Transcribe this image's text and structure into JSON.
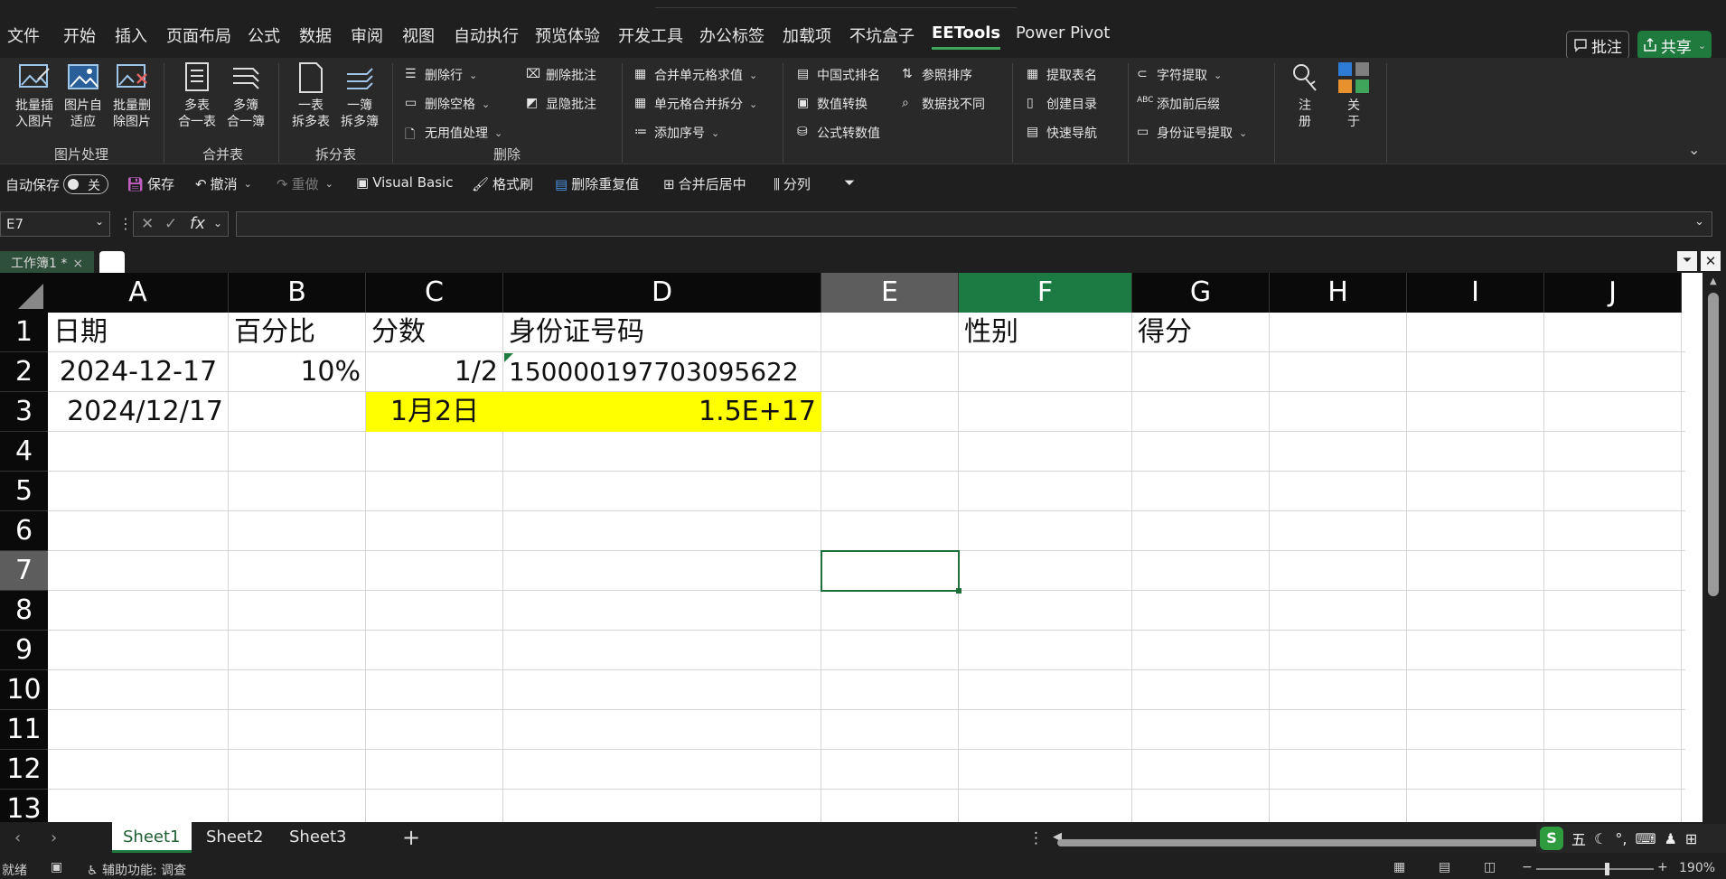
{
  "menu": {
    "tabs": [
      "文件",
      "开始",
      "插入",
      "页面布局",
      "公式",
      "数据",
      "审阅",
      "视图",
      "自动执行",
      "预览体验",
      "开发工具",
      "办公标签",
      "加载项",
      "不坑盒子",
      "EETools",
      "Power Pivot"
    ],
    "active_tab": "EETools",
    "comment_btn": "批注",
    "share_btn": "共享"
  },
  "ribbon": {
    "img_group": {
      "label": "图片处理",
      "btn1": "批量插\n入图片",
      "btn2": "图片自\n适应",
      "btn3": "批量删\n除图片"
    },
    "merge_group": {
      "label": "合并表",
      "btn1": "多表\n合一表",
      "btn2": "多簿\n合一簿"
    },
    "split_group": {
      "label": "拆分表",
      "btn1": "一表\n拆多表",
      "btn2": "一簿\n拆多簿"
    },
    "delete_group": {
      "label": "删除",
      "del_row": "删除行",
      "del_space": "删除空格",
      "useless": "无用值处理",
      "del_comment": "删除批注",
      "show_comment": "显隐批注"
    },
    "cell_group": {
      "merge_sum": "合并单元格求值",
      "merge_split": "单元格合并拆分",
      "add_seq": "添加序号"
    },
    "rank_group": {
      "cn_rank": "中国式排名",
      "num_convert": "数值转换",
      "formula_to_value": "公式转数值",
      "ref_sort": "参照排序",
      "data_diff": "数据找不同"
    },
    "nav_group": {
      "extract_name": "提取表名",
      "create_toc": "创建目录",
      "quick_nav": "快速导航"
    },
    "text_group": {
      "char_extract": "字符提取",
      "add_fix": "添加前后缀",
      "id_extract": "身份证号提取"
    },
    "reg_btn": "注\n册",
    "about_btn": "关\n于"
  },
  "qat": {
    "autosave": "自动保存",
    "toggle_state": "关",
    "save": "保存",
    "undo": "撤消",
    "redo": "重做",
    "vb": "Visual Basic",
    "format_painter": "格式刷",
    "remove_dup": "删除重复值",
    "merge_center": "合并后居中",
    "split_col": "分列"
  },
  "formula_bar": {
    "name_box": "E7",
    "fx": "fx",
    "value": ""
  },
  "workbook_tab": "工作簿1 *",
  "columns": [
    "A",
    "B",
    "C",
    "D",
    "E",
    "F",
    "G",
    "H",
    "I",
    "J"
  ],
  "rows": [
    "1",
    "2",
    "3",
    "4",
    "5",
    "6",
    "7",
    "8",
    "9",
    "10",
    "11",
    "12",
    "13"
  ],
  "cells": {
    "A1": "日期",
    "B1": "百分比",
    "C1": "分数",
    "D1": "身份证号码",
    "F1": "性别",
    "G1": "得分",
    "A2": "2024-12-17",
    "B2": "10%",
    "C2": "1/2",
    "D2": "150000197703095622",
    "A3": "2024/12/17",
    "C3": "1月2日",
    "D3": "1.5E+17"
  },
  "highlight_color": "#ffff00",
  "accent_color": "#1f7a3e",
  "sheets": [
    "Sheet1",
    "Sheet2",
    "Sheet3"
  ],
  "active_sheet": "Sheet1",
  "status": {
    "ready": "就绪",
    "accessibility": "辅助功能: 调查",
    "zoom": "190%"
  }
}
